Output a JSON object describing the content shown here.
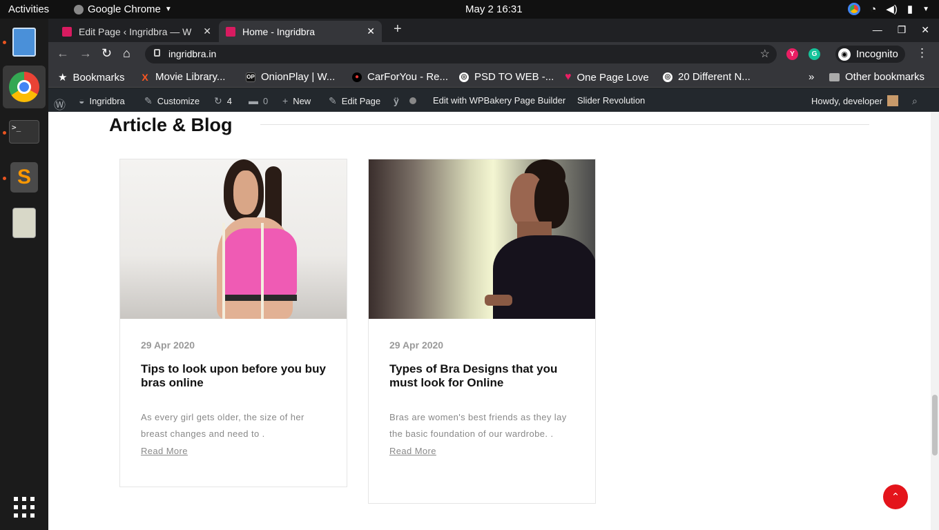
{
  "topbar": {
    "activities": "Activities",
    "app_name": "Google Chrome",
    "clock": "May 2  16:31"
  },
  "browser": {
    "tabs": [
      {
        "title": "Edit Page ‹ Ingridbra — W",
        "active": false
      },
      {
        "title": "Home - Ingridbra",
        "active": true
      }
    ],
    "url": "ingridbra.in",
    "profile_label": "Incognito",
    "bookmarks": [
      "Bookmarks",
      "Movie Library...",
      "OnionPlay | W...",
      "CarForYou - Re...",
      "PSD TO WEB -...",
      "One Page Love",
      "20 Different N..."
    ],
    "other_bookmarks": "Other bookmarks"
  },
  "wp_admin_bar": {
    "site_name": "Ingridbra",
    "customize": "Customize",
    "updates_count": "4",
    "comments_count": "0",
    "new": "New",
    "edit_page": "Edit Page",
    "wpbakery": "Edit with WPBakery Page Builder",
    "slider_revolution": "Slider Revolution",
    "greeting": "Howdy, developer"
  },
  "page": {
    "section_title": "Article & Blog",
    "posts": [
      {
        "date": "29 Apr 2020",
        "title": "Tips to look upon before you buy bras online",
        "excerpt": "As every girl gets older, the size of her breast changes and need to .",
        "read_more": "Read More"
      },
      {
        "date": "29 Apr 2020",
        "title": "Types of Bra Designs that you must look for Online",
        "excerpt": "Bras are women's best friends as they lay the basic foundation of our wardrobe. .",
        "read_more": "Read More"
      }
    ]
  },
  "colors": {
    "accent": "#e4141b",
    "wp_bar": "#23282d",
    "chrome_dark": "#202124"
  }
}
